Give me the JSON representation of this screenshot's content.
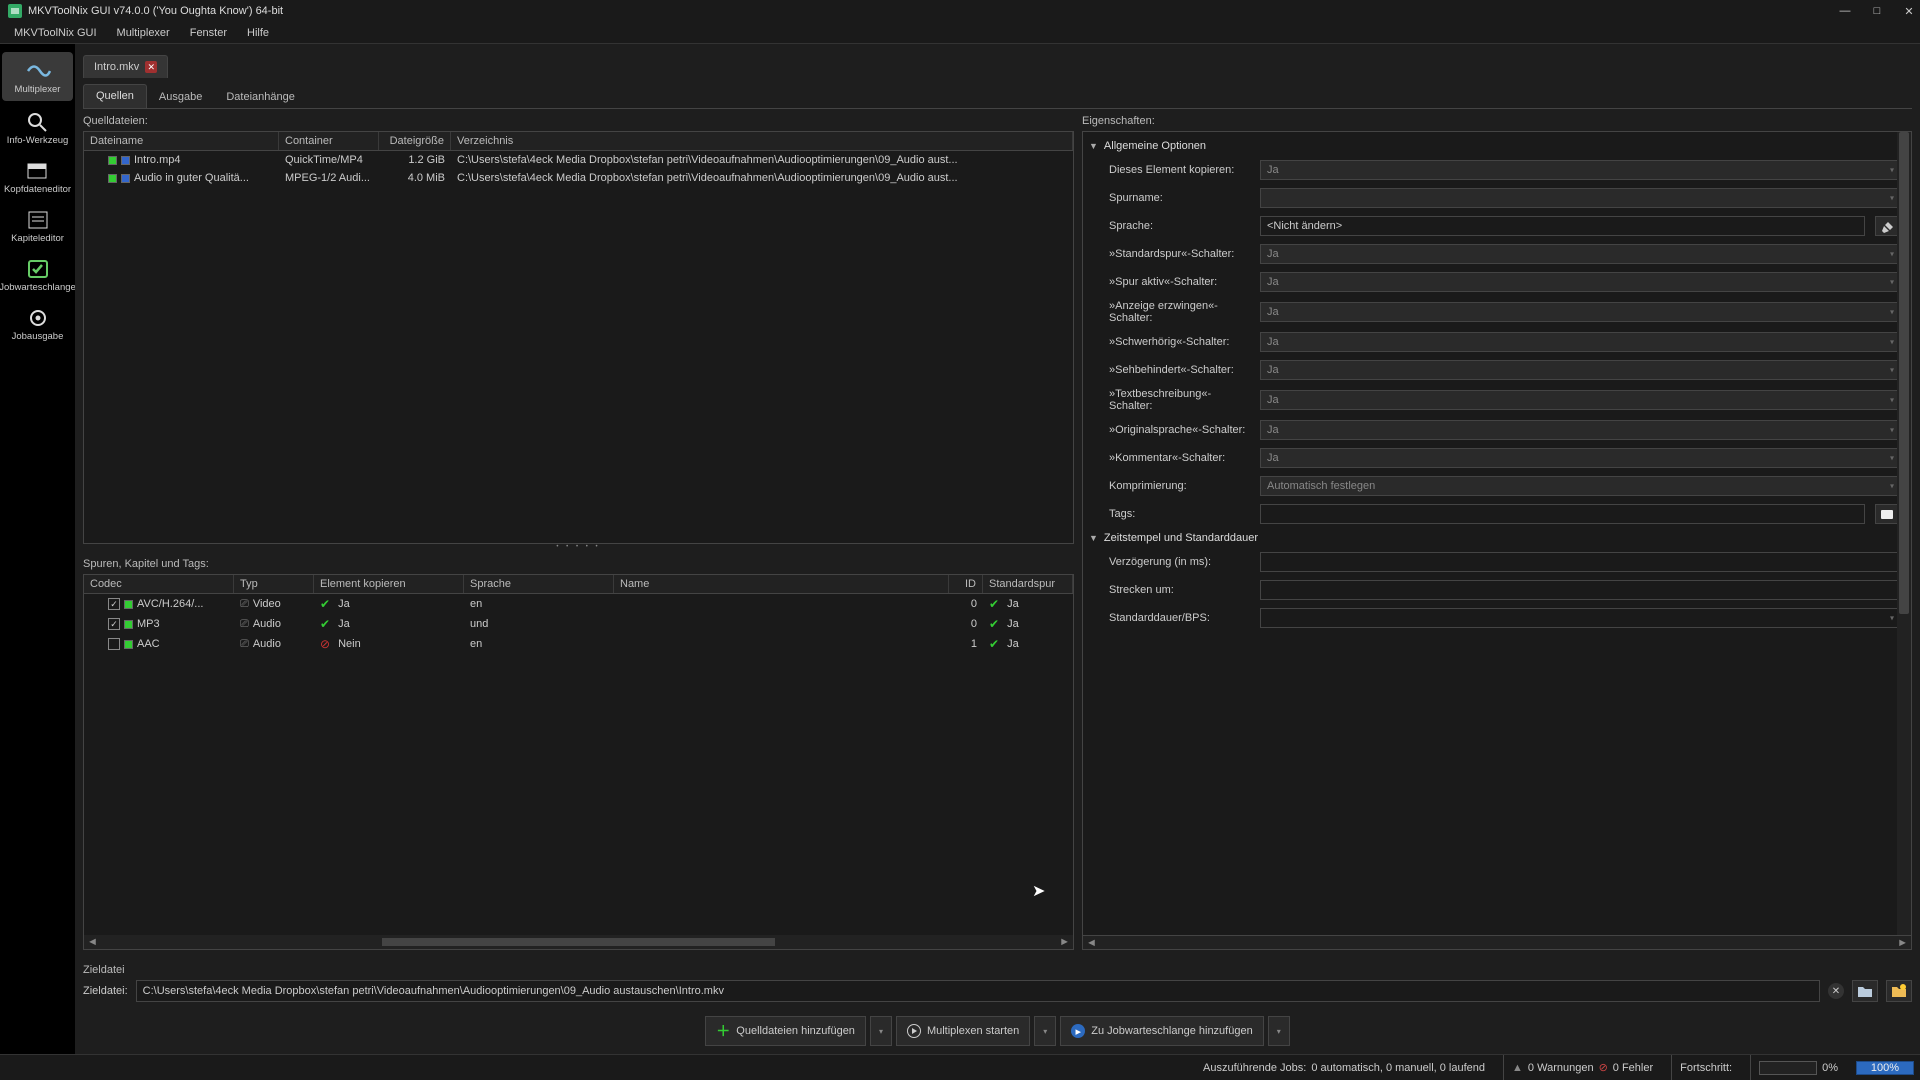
{
  "titlebar": {
    "text": "MKVToolNix GUI v74.0.0 ('You Oughta Know') 64-bit"
  },
  "menus": {
    "app": "MKVToolNix GUI",
    "mux": "Multiplexer",
    "window": "Fenster",
    "help": "Hilfe"
  },
  "vtools": {
    "multiplexer": "Multiplexer",
    "infowerkzeug": "Info-Werkzeug",
    "kopfdaten": "Kopfdateneditor",
    "kapitel": "Kapiteleditor",
    "jobwarte": "Jobwarteschlange",
    "jobausgabe": "Jobausgabe"
  },
  "tab": {
    "name": "Intro.mkv"
  },
  "subtabs": {
    "quellen": "Quellen",
    "ausgabe": "Ausgabe",
    "anhange": "Dateianhänge"
  },
  "sourceFiles": {
    "label": "Quelldateien:",
    "cols": {
      "name": "Dateiname",
      "container": "Container",
      "size": "Dateigröße",
      "dir": "Verzeichnis"
    },
    "rows": [
      {
        "name": "Intro.mp4",
        "container": "QuickTime/MP4",
        "size": "1.2 GiB",
        "dir": "C:\\Users\\stefa\\4eck Media Dropbox\\stefan petri\\Videoaufnahmen\\Audiooptimierungen\\09_Audio aust..."
      },
      {
        "name": "Audio in guter Qualitä...",
        "container": "MPEG-1/2 Audi...",
        "size": "4.0 MiB",
        "dir": "C:\\Users\\stefa\\4eck Media Dropbox\\stefan petri\\Videoaufnahmen\\Audiooptimierungen\\09_Audio aust..."
      }
    ]
  },
  "tracks": {
    "label": "Spuren, Kapitel und Tags:",
    "cols": {
      "codec": "Codec",
      "typ": "Typ",
      "kopieren": "Element kopieren",
      "sprache": "Sprache",
      "name": "Name",
      "id": "ID",
      "standard": "Standardspur"
    },
    "rows": [
      {
        "checked": true,
        "codec": "AVC/H.264/...",
        "typ": "Video",
        "kopieren": "Ja",
        "kopierenYes": true,
        "sprache": "en",
        "name": "",
        "id": "0",
        "standard": "Ja"
      },
      {
        "checked": true,
        "codec": "MP3",
        "typ": "Audio",
        "kopieren": "Ja",
        "kopierenYes": true,
        "sprache": "und",
        "name": "",
        "id": "0",
        "standard": "Ja"
      },
      {
        "checked": false,
        "codec": "AAC",
        "typ": "Audio",
        "kopieren": "Nein",
        "kopierenYes": false,
        "sprache": "en",
        "name": "",
        "id": "1",
        "standard": "Ja"
      }
    ]
  },
  "props": {
    "label": "Eigenschaften:",
    "group1": "Allgemeine Optionen",
    "copyEl": {
      "label": "Dieses Element kopieren:",
      "value": "Ja"
    },
    "trackName": {
      "label": "Spurname:",
      "value": ""
    },
    "language": {
      "label": "Sprache:",
      "value": "<Nicht ändern>"
    },
    "defaultTrack": {
      "label": "»Standardspur«-Schalter:",
      "value": "Ja"
    },
    "trackActive": {
      "label": "»Spur aktiv«-Schalter:",
      "value": "Ja"
    },
    "forceDisp": {
      "label": "»Anzeige erzwingen«-Schalter:",
      "value": "Ja"
    },
    "hearingImp": {
      "label": "»Schwerhörig«-Schalter:",
      "value": "Ja"
    },
    "visualImp": {
      "label": "»Sehbehindert«-Schalter:",
      "value": "Ja"
    },
    "textDesc": {
      "label": "»Textbeschreibung«-Schalter:",
      "value": "Ja"
    },
    "origLang": {
      "label": "»Originalsprache«-Schalter:",
      "value": "Ja"
    },
    "commentary": {
      "label": "»Kommentar«-Schalter:",
      "value": "Ja"
    },
    "compression": {
      "label": "Komprimierung:",
      "value": "Automatisch festlegen"
    },
    "tags": {
      "label": "Tags:",
      "value": ""
    },
    "group2": "Zeitstempel und Standarddauer",
    "delay": {
      "label": "Verzögerung (in ms):",
      "value": ""
    },
    "stretch": {
      "label": "Strecken um:",
      "value": ""
    },
    "duration": {
      "label": "Standarddauer/BPS:",
      "value": ""
    }
  },
  "dest": {
    "heading": "Zieldatei",
    "label": "Zieldatei:",
    "path": "C:\\Users\\stefa\\4eck Media Dropbox\\stefan petri\\Videoaufnahmen\\Audiooptimierungen\\09_Audio austauschen\\Intro.mkv"
  },
  "actions": {
    "add": "Quelldateien hinzufügen",
    "start": "Multiplexen starten",
    "queue": "Zu Jobwarteschlange hinzufügen"
  },
  "status": {
    "jobs": "Auszuführende Jobs:",
    "jobsVal": "0 automatisch, 0 manuell, 0 laufend",
    "warn": "0 Warnungen",
    "err": "0 Fehler",
    "progress": "Fortschritt:",
    "pct0": "0%",
    "pct100": "100%"
  }
}
